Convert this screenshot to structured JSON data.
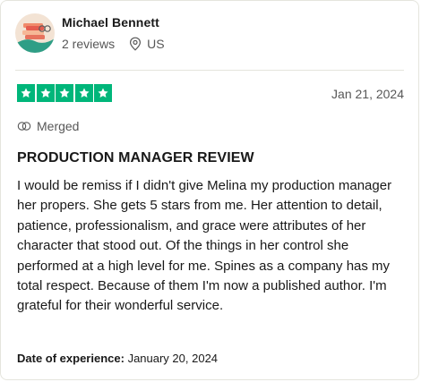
{
  "reviewer": {
    "name": "Michael Bennett",
    "reviews_count": "2 reviews",
    "country": "US"
  },
  "review": {
    "rating": 5,
    "rating_max": 5,
    "star_color": "#00b67a",
    "date": "Jan 21, 2024",
    "merged_label": "Merged",
    "title": "PRODUCTION MANAGER REVIEW",
    "body": "I would be remiss if I didn't give Melina my production manager her propers. She gets 5 stars from me. Her attention to detail, patience, professionalism, and grace were attributes of her character that stood out. Of the things in her control she performed at a high level for me. Spines as a company has my total respect. Because of them I'm now a published author. I'm grateful for their wonderful service.",
    "experience_label": "Date of experience:",
    "experience_date": "January 20, 2024"
  },
  "icons": {
    "location": "location-pin-icon",
    "merged": "merged-icon",
    "star": "star-icon"
  }
}
